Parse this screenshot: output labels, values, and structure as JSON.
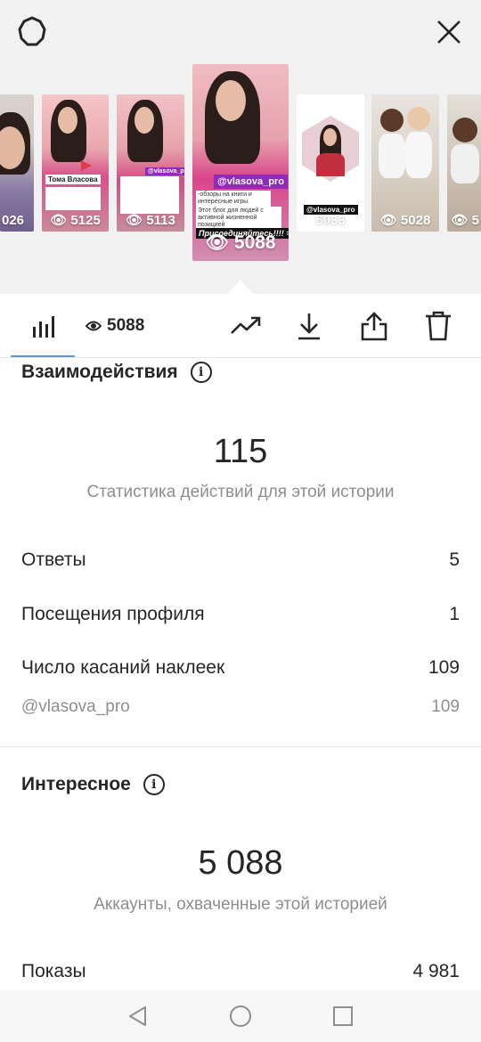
{
  "icons": {
    "settings": "gear-icon",
    "close": "close-icon",
    "stats": "bar-chart-icon",
    "eye": "eye-icon",
    "trend": "trending-up-icon",
    "download": "download-icon",
    "share": "share-icon",
    "delete": "trash-icon",
    "info": "info-icon",
    "back": "back-triangle-icon",
    "home": "home-circle-icon",
    "recents": "recents-square-icon"
  },
  "colors": {
    "accent_tab": "#5b9bd5",
    "mention_purple": "#8e2bb8",
    "text_primary": "#262626",
    "text_muted": "#8e8e8e"
  },
  "stories": [
    {
      "count": "026"
    },
    {
      "count": "5125",
      "name_label": "Тома Власова"
    },
    {
      "count": "5113",
      "mention": "@vlasova_pro"
    },
    {
      "count": "5088",
      "mention": "@vlasova_pro",
      "caption": "-обзоры на книги и интересные игры",
      "text": "Этот блог для людей с активной жизненной позицией",
      "cta": "Присоединяйтесь!!!! =",
      "selected": true
    },
    {
      "count": "5033",
      "mention": "@vlasova_pro"
    },
    {
      "count": "5028"
    },
    {
      "count": "5"
    }
  ],
  "toolbar": {
    "views_count": "5088"
  },
  "interactions": {
    "title": "Взаимодействия",
    "total": "115",
    "subtitle": "Статистика действий для этой истории",
    "rows": [
      {
        "label": "Ответы",
        "value": "5"
      },
      {
        "label": "Посещения профиля",
        "value": "1"
      },
      {
        "label": "Число касаний наклеек",
        "value": "109"
      }
    ],
    "sticker": {
      "label": "@vlasova_pro",
      "value": "109"
    }
  },
  "discovery": {
    "title": "Интересное",
    "total": "5 088",
    "subtitle": "Аккаунты, охваченные этой историей",
    "rows": [
      {
        "label": "Показы",
        "value": "4 981"
      }
    ]
  }
}
